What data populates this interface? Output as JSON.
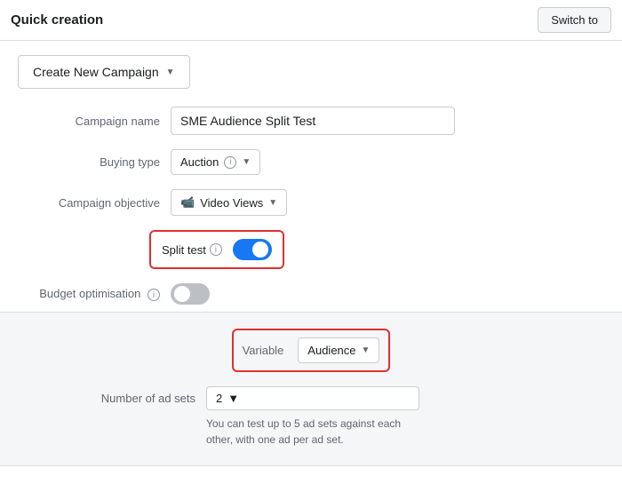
{
  "topbar": {
    "title": "Quick creation",
    "switch_btn": "Switch to"
  },
  "main": {
    "create_campaign_btn": "Create New Campaign",
    "form": {
      "campaign_name_label": "Campaign name",
      "campaign_name_value": "SME Audience Split Test",
      "buying_type_label": "Buying type",
      "buying_type_value": "Auction",
      "campaign_objective_label": "Campaign objective",
      "campaign_objective_value": "Video Views",
      "split_test_label": "Split test",
      "split_test_on": true,
      "budget_optimisation_label": "Budget optimisation",
      "budget_optimisation_on": false
    },
    "variable_section": {
      "variable_label": "Variable",
      "variable_value": "Audience",
      "num_adsets_label": "Number of ad sets",
      "num_adsets_value": "2",
      "helper_text": "You can test up to 5 ad sets against each other, with one ad per ad set."
    }
  }
}
